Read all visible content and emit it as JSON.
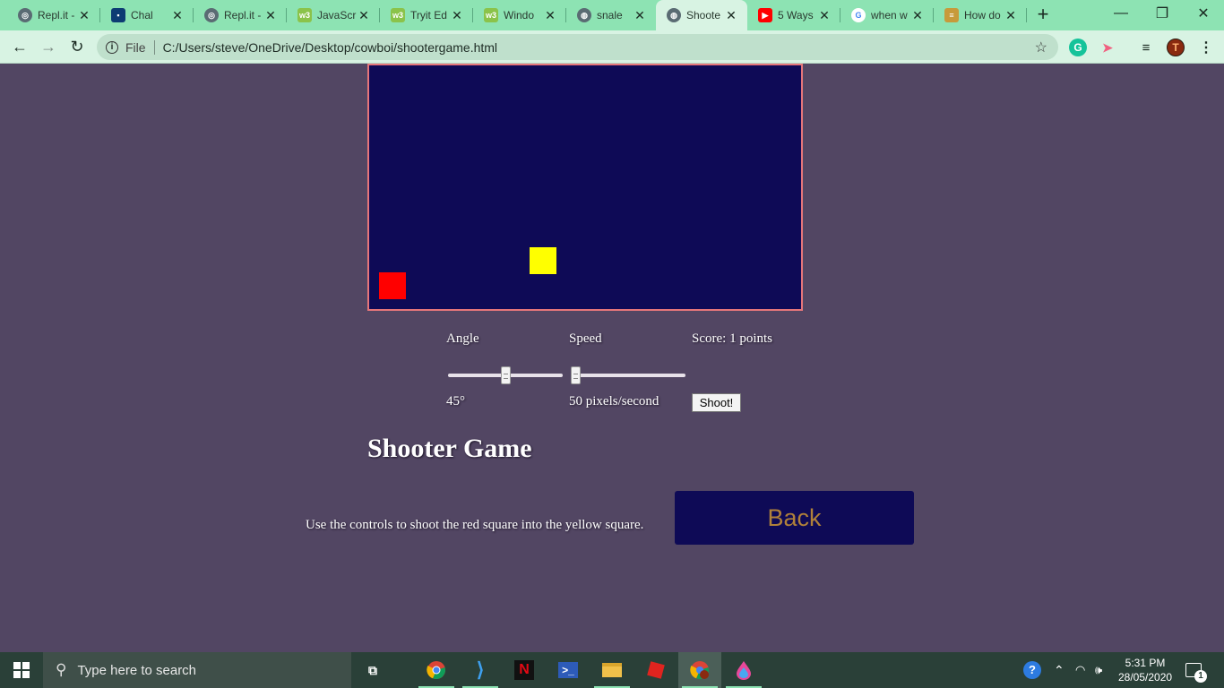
{
  "browser": {
    "tabs": [
      {
        "label": "Repl.it -",
        "icon": "replit-icon",
        "color": "#5a6b73"
      },
      {
        "label": "Chal",
        "icon": "lock-icon",
        "color": "#0d3c73"
      },
      {
        "label": "Repl.it -",
        "icon": "replit-icon",
        "color": "#5a6b73"
      },
      {
        "label": "JavaScr",
        "icon": "w3schools-icon",
        "color": "#8bc34a"
      },
      {
        "label": "Tryit Ed",
        "icon": "w3schools-icon",
        "color": "#8bc34a"
      },
      {
        "label": "Windo",
        "icon": "w3schools-icon",
        "color": "#8bc34a"
      },
      {
        "label": "snale",
        "icon": "globe-icon",
        "color": "#5a6b73"
      },
      {
        "label": "Shoote",
        "icon": "globe-icon",
        "color": "#5a6b73"
      },
      {
        "label": "5 Ways",
        "icon": "youtube-icon",
        "color": "#ff0000"
      },
      {
        "label": "when w",
        "icon": "google-icon",
        "color": "#4285f4"
      },
      {
        "label": "How do",
        "icon": "stackoverflow-icon",
        "color": "#c79a3a"
      }
    ],
    "active_tab_index": 7,
    "new_tab_label": "+",
    "file_label": "File",
    "url": "C:/Users/steve/OneDrive/Desktop/cowboi/shootergame.html",
    "profile_initial": "T",
    "grammarly_label": "G"
  },
  "game": {
    "angle_label": "Angle",
    "speed_label": "Speed",
    "score_text": "Score: 1 points",
    "angle_value": "45°",
    "speed_value": "50 pixels/second",
    "angle_slider_fraction": 0.5,
    "speed_slider_fraction": 0.0,
    "shoot_label": "Shoot!",
    "title": "Shooter Game",
    "instructions": "Use the controls to shoot the red square into the yellow square.",
    "back_label": "Back",
    "colors": {
      "canvas": "#0e0a56",
      "canvas_border": "#e5767a",
      "player": "#ff0000",
      "target": "#ffff00",
      "back_text": "#b0813a"
    }
  },
  "taskbar": {
    "search_placeholder": "Type here to search",
    "pinned": [
      "task-view-icon",
      "chrome-icon",
      "vscode-icon",
      "netflix-icon",
      "powershell-icon",
      "file-explorer-icon",
      "roblox-icon",
      "chrome-profile-icon",
      "paint3d-icon"
    ],
    "time": "5:31 PM",
    "date": "28/05/2020",
    "notification_count": "1"
  }
}
